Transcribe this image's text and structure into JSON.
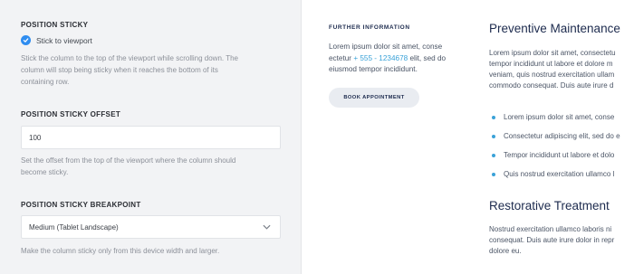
{
  "settings": {
    "sticky": {
      "title": "POSITION STICKY",
      "checkbox_label": "Stick to viewport",
      "description_lines": [
        "Stick the column to the top of the viewport while scrolling down. The",
        "column will stop being sticky when it reaches the bottom of its",
        "containing row."
      ]
    },
    "offset": {
      "title": "POSITION STICKY OFFSET",
      "value": "100",
      "description_lines": [
        "Set the offset from the top of the viewport where the column should",
        "become sticky."
      ]
    },
    "breakpoint": {
      "title": "POSITION STICKY BREAKPOINT",
      "selected": "Medium (Tablet Landscape)",
      "description": "Make the column sticky only from this device width and larger."
    }
  },
  "preview": {
    "further_info": {
      "heading": "FURTHER INFORMATION",
      "line1": "Lorem ipsum dolor sit amet, conse",
      "line2_start": "ectetur ",
      "phone": "+ 555 - 1234678",
      "line2_end": " elit, sed do",
      "line3": "eiusmod tempor incididunt.",
      "button_label": "BOOK APPOINTMENT"
    },
    "preventive": {
      "title": "Preventive Maintenance",
      "lines": [
        "Lorem ipsum dolor sit amet, consectetu",
        "tempor incididunt ut labore et dolore m",
        "veniam, quis nostrud exercitation ullam",
        "commodo consequat. Duis aute irure d"
      ],
      "bullets": [
        "Lorem ipsum dolor sit amet, conse",
        "Consectetur adipiscing elit, sed do e",
        "Tempor incididunt ut labore et dolo",
        "Quis nostrud exercitation ullamco l"
      ]
    },
    "restorative": {
      "title": "Restorative Treatment",
      "lines": [
        "Nostrud exercitation ullamco laboris ni",
        "consequat. Duis aute irure dolor in repr",
        "dolore eu."
      ]
    }
  },
  "colors": {
    "accent": "#2f8df0",
    "link": "#3aa2d8",
    "heading": "#1d2b4e",
    "panel_bg": "#f2f3f5"
  },
  "icons": {
    "checkbox": "check-circle-icon",
    "select": "chevron-down-icon"
  }
}
